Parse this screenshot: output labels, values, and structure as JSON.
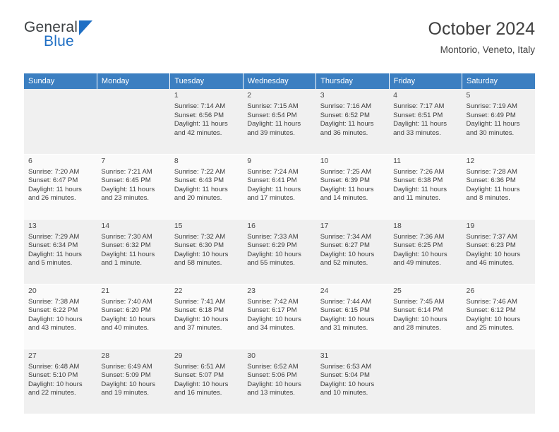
{
  "brand": {
    "name_top": "General",
    "name_bottom": "Blue",
    "triangle_icon": "triangle-logo-icon",
    "color_primary": "#1f6fc4",
    "color_text": "#3c4043"
  },
  "header": {
    "title": "October 2024",
    "subtitle": "Montorio, Veneto, Italy"
  },
  "calendar": {
    "header_bg": "#3c7fc1",
    "weekdays": [
      "Sunday",
      "Monday",
      "Tuesday",
      "Wednesday",
      "Thursday",
      "Friday",
      "Saturday"
    ],
    "weeks": [
      [
        {
          "day": "",
          "lines": []
        },
        {
          "day": "",
          "lines": []
        },
        {
          "day": "1",
          "lines": [
            "Sunrise: 7:14 AM",
            "Sunset: 6:56 PM",
            "Daylight: 11 hours",
            "and 42 minutes."
          ]
        },
        {
          "day": "2",
          "lines": [
            "Sunrise: 7:15 AM",
            "Sunset: 6:54 PM",
            "Daylight: 11 hours",
            "and 39 minutes."
          ]
        },
        {
          "day": "3",
          "lines": [
            "Sunrise: 7:16 AM",
            "Sunset: 6:52 PM",
            "Daylight: 11 hours",
            "and 36 minutes."
          ]
        },
        {
          "day": "4",
          "lines": [
            "Sunrise: 7:17 AM",
            "Sunset: 6:51 PM",
            "Daylight: 11 hours",
            "and 33 minutes."
          ]
        },
        {
          "day": "5",
          "lines": [
            "Sunrise: 7:19 AM",
            "Sunset: 6:49 PM",
            "Daylight: 11 hours",
            "and 30 minutes."
          ]
        }
      ],
      [
        {
          "day": "6",
          "lines": [
            "Sunrise: 7:20 AM",
            "Sunset: 6:47 PM",
            "Daylight: 11 hours",
            "and 26 minutes."
          ]
        },
        {
          "day": "7",
          "lines": [
            "Sunrise: 7:21 AM",
            "Sunset: 6:45 PM",
            "Daylight: 11 hours",
            "and 23 minutes."
          ]
        },
        {
          "day": "8",
          "lines": [
            "Sunrise: 7:22 AM",
            "Sunset: 6:43 PM",
            "Daylight: 11 hours",
            "and 20 minutes."
          ]
        },
        {
          "day": "9",
          "lines": [
            "Sunrise: 7:24 AM",
            "Sunset: 6:41 PM",
            "Daylight: 11 hours",
            "and 17 minutes."
          ]
        },
        {
          "day": "10",
          "lines": [
            "Sunrise: 7:25 AM",
            "Sunset: 6:39 PM",
            "Daylight: 11 hours",
            "and 14 minutes."
          ]
        },
        {
          "day": "11",
          "lines": [
            "Sunrise: 7:26 AM",
            "Sunset: 6:38 PM",
            "Daylight: 11 hours",
            "and 11 minutes."
          ]
        },
        {
          "day": "12",
          "lines": [
            "Sunrise: 7:28 AM",
            "Sunset: 6:36 PM",
            "Daylight: 11 hours",
            "and 8 minutes."
          ]
        }
      ],
      [
        {
          "day": "13",
          "lines": [
            "Sunrise: 7:29 AM",
            "Sunset: 6:34 PM",
            "Daylight: 11 hours",
            "and 5 minutes."
          ]
        },
        {
          "day": "14",
          "lines": [
            "Sunrise: 7:30 AM",
            "Sunset: 6:32 PM",
            "Daylight: 11 hours",
            "and 1 minute."
          ]
        },
        {
          "day": "15",
          "lines": [
            "Sunrise: 7:32 AM",
            "Sunset: 6:30 PM",
            "Daylight: 10 hours",
            "and 58 minutes."
          ]
        },
        {
          "day": "16",
          "lines": [
            "Sunrise: 7:33 AM",
            "Sunset: 6:29 PM",
            "Daylight: 10 hours",
            "and 55 minutes."
          ]
        },
        {
          "day": "17",
          "lines": [
            "Sunrise: 7:34 AM",
            "Sunset: 6:27 PM",
            "Daylight: 10 hours",
            "and 52 minutes."
          ]
        },
        {
          "day": "18",
          "lines": [
            "Sunrise: 7:36 AM",
            "Sunset: 6:25 PM",
            "Daylight: 10 hours",
            "and 49 minutes."
          ]
        },
        {
          "day": "19",
          "lines": [
            "Sunrise: 7:37 AM",
            "Sunset: 6:23 PM",
            "Daylight: 10 hours",
            "and 46 minutes."
          ]
        }
      ],
      [
        {
          "day": "20",
          "lines": [
            "Sunrise: 7:38 AM",
            "Sunset: 6:22 PM",
            "Daylight: 10 hours",
            "and 43 minutes."
          ]
        },
        {
          "day": "21",
          "lines": [
            "Sunrise: 7:40 AM",
            "Sunset: 6:20 PM",
            "Daylight: 10 hours",
            "and 40 minutes."
          ]
        },
        {
          "day": "22",
          "lines": [
            "Sunrise: 7:41 AM",
            "Sunset: 6:18 PM",
            "Daylight: 10 hours",
            "and 37 minutes."
          ]
        },
        {
          "day": "23",
          "lines": [
            "Sunrise: 7:42 AM",
            "Sunset: 6:17 PM",
            "Daylight: 10 hours",
            "and 34 minutes."
          ]
        },
        {
          "day": "24",
          "lines": [
            "Sunrise: 7:44 AM",
            "Sunset: 6:15 PM",
            "Daylight: 10 hours",
            "and 31 minutes."
          ]
        },
        {
          "day": "25",
          "lines": [
            "Sunrise: 7:45 AM",
            "Sunset: 6:14 PM",
            "Daylight: 10 hours",
            "and 28 minutes."
          ]
        },
        {
          "day": "26",
          "lines": [
            "Sunrise: 7:46 AM",
            "Sunset: 6:12 PM",
            "Daylight: 10 hours",
            "and 25 minutes."
          ]
        }
      ],
      [
        {
          "day": "27",
          "lines": [
            "Sunrise: 6:48 AM",
            "Sunset: 5:10 PM",
            "Daylight: 10 hours",
            "and 22 minutes."
          ]
        },
        {
          "day": "28",
          "lines": [
            "Sunrise: 6:49 AM",
            "Sunset: 5:09 PM",
            "Daylight: 10 hours",
            "and 19 minutes."
          ]
        },
        {
          "day": "29",
          "lines": [
            "Sunrise: 6:51 AM",
            "Sunset: 5:07 PM",
            "Daylight: 10 hours",
            "and 16 minutes."
          ]
        },
        {
          "day": "30",
          "lines": [
            "Sunrise: 6:52 AM",
            "Sunset: 5:06 PM",
            "Daylight: 10 hours",
            "and 13 minutes."
          ]
        },
        {
          "day": "31",
          "lines": [
            "Sunrise: 6:53 AM",
            "Sunset: 5:04 PM",
            "Daylight: 10 hours",
            "and 10 minutes."
          ]
        },
        {
          "day": "",
          "lines": []
        },
        {
          "day": "",
          "lines": []
        }
      ]
    ]
  }
}
